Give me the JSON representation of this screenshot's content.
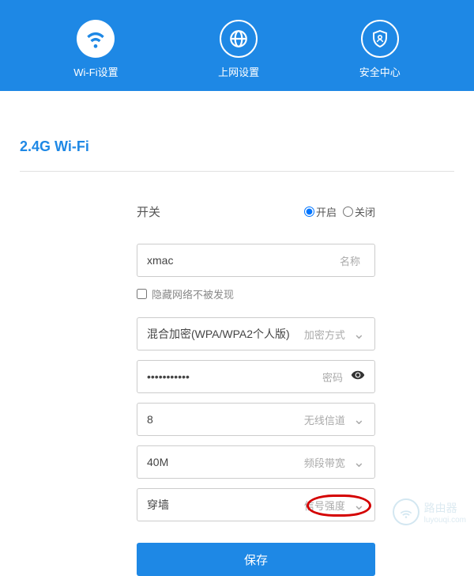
{
  "header": {
    "tabs": [
      {
        "label": "Wi-Fi设置",
        "icon": "wifi-icon",
        "active": true
      },
      {
        "label": "上网设置",
        "icon": "globe-icon",
        "active": false
      },
      {
        "label": "安全中心",
        "icon": "shield-icon",
        "active": false
      }
    ]
  },
  "section_title": "2.4G Wi-Fi",
  "switch": {
    "label": "开关",
    "on_label": "开启",
    "off_label": "关闭",
    "value": "on"
  },
  "fields": {
    "ssid": {
      "value": "xmac",
      "hint": "名称"
    },
    "hide_network": {
      "label": "隐藏网络不被发现",
      "checked": false
    },
    "encryption": {
      "value": "混合加密(WPA/WPA2个人版)",
      "hint": "加密方式"
    },
    "password": {
      "value": "•••••••••••",
      "hint": "密码"
    },
    "channel": {
      "value": "8",
      "hint": "无线信道"
    },
    "bandwidth": {
      "value": "40M",
      "hint": "频段带宽"
    },
    "signal": {
      "value": "穿墙",
      "hint": "信号强度"
    }
  },
  "save_label": "保存",
  "watermark": {
    "brand": "路由器",
    "url": "luyouqi.com"
  }
}
